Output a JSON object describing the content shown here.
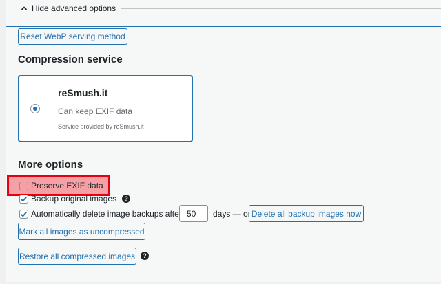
{
  "advanced": {
    "toggle_label": "Hide advanced options"
  },
  "buttons": {
    "reset_webp": "Reset WebP serving method",
    "delete_backups": "Delete all backup images now",
    "mark_uncompressed": "Mark all images as uncompressed",
    "restore_compressed": "Restore all compressed images"
  },
  "compression": {
    "heading": "Compression service",
    "service_name": "reSmush.it",
    "service_desc": "Can keep EXIF data",
    "service_credit": "Service provided by reSmush.it"
  },
  "more_options": {
    "heading": "More options",
    "preserve_exif": "Preserve EXIF data",
    "backup_original": "Backup original images",
    "auto_delete": "Automatically delete image backups after",
    "days_value": "50",
    "days_suffix": "days — or"
  },
  "colors": {
    "accent": "#2271b1",
    "highlight_border": "#e50012",
    "highlight_fill": "#f5a0a4"
  },
  "icons": {
    "toggle": "chevron-up-icon",
    "help": "help-icon",
    "check": "checkmark-icon"
  }
}
